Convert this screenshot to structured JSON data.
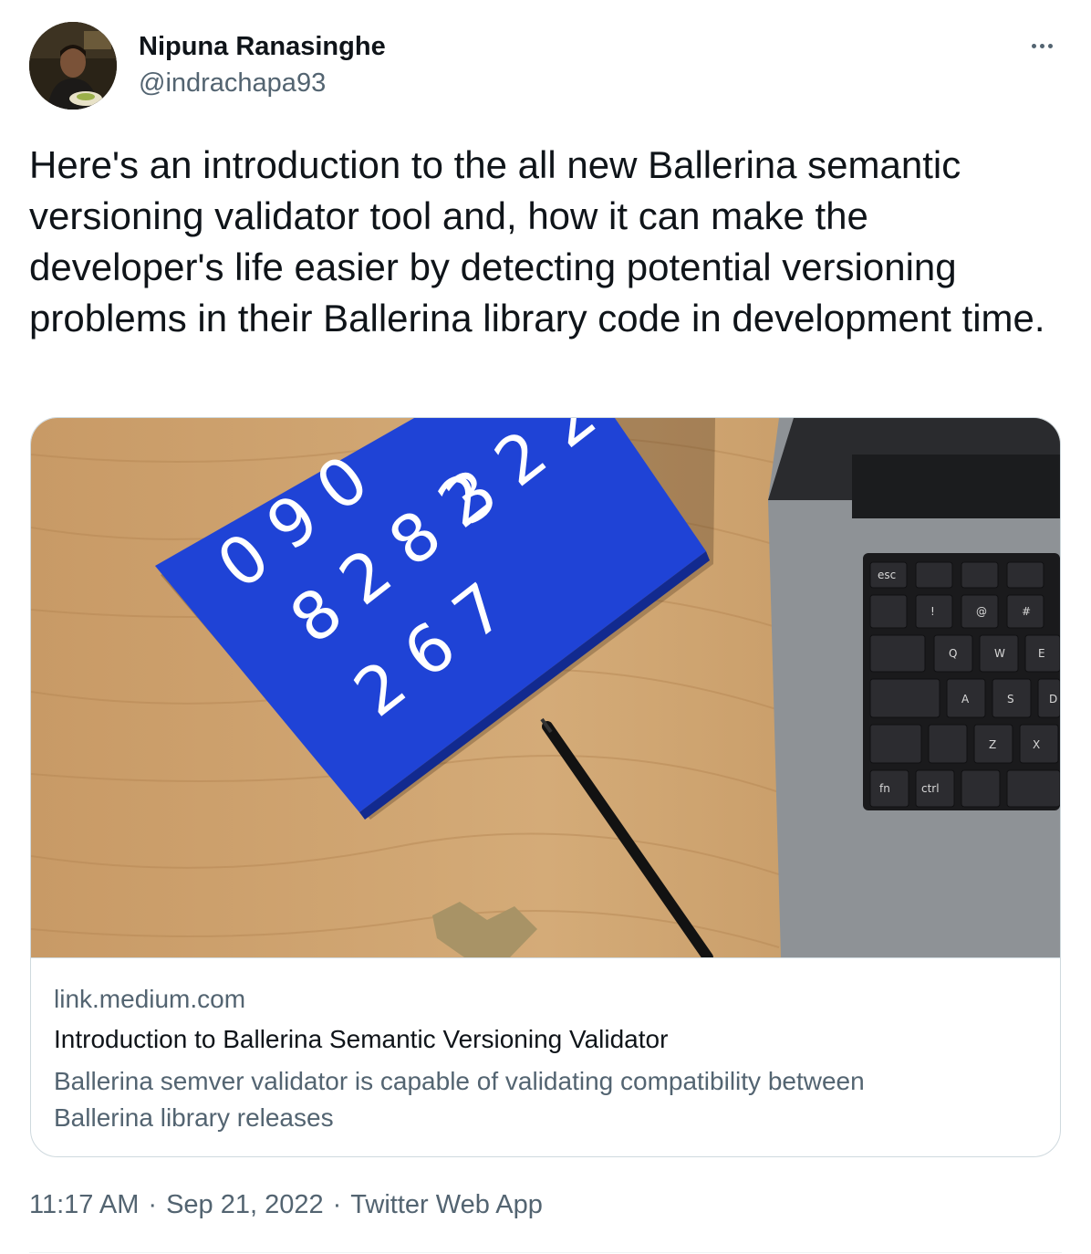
{
  "author": {
    "name": "Nipuna Ranasinghe",
    "handle": "@indrachapa93"
  },
  "tweet": {
    "text": "Here's an introduction to the all new Ballerina semantic versioning validator tool and, how it can make the developer's life easier by detecting potential versioning problems in their Ballerina library code in development time."
  },
  "card": {
    "domain": "link.medium.com",
    "title": "Introduction to Ballerina Semantic Versioning Validator",
    "description": "Ballerina semver validator is capable of validating compatibility between Ballerina library releases",
    "image": {
      "notebook_digits": "0 9 0 3 2 2 0 8 2 8 2 6 7",
      "keyboard_keys": [
        "esc",
        "!",
        "@",
        "#",
        "Q",
        "W",
        "E",
        "A",
        "S",
        "D",
        "Z",
        "X",
        "fn",
        "ctrl"
      ],
      "colors": {
        "notebook": "#1f43d6",
        "wood": "#c99f6c",
        "laptop": "#8e9296"
      }
    }
  },
  "meta": {
    "time": "11:17 AM",
    "separator1": "·",
    "date": "Sep 21, 2022",
    "separator2": "·",
    "source": "Twitter Web App"
  }
}
